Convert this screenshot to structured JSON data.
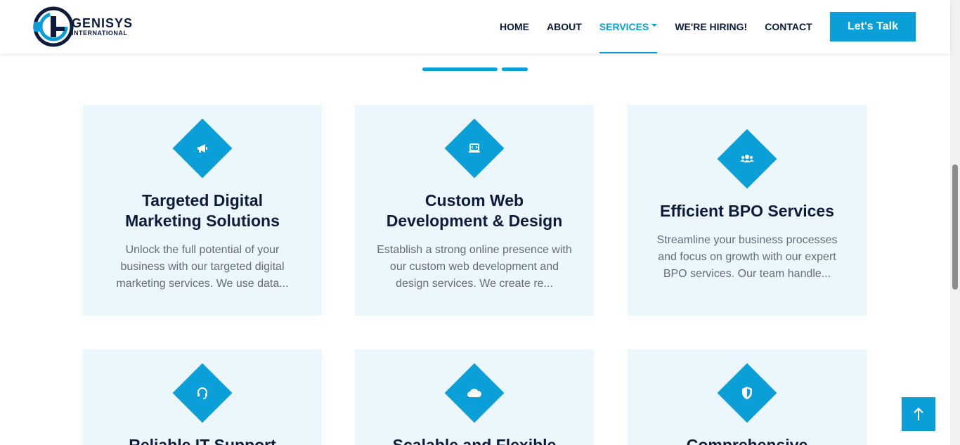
{
  "brand": {
    "name_big": "GENISYS",
    "name_small": "INTERNATIONAL"
  },
  "nav": {
    "items": [
      {
        "label": "HOME"
      },
      {
        "label": "ABOUT"
      },
      {
        "label": "SERVICES"
      },
      {
        "label": "WE'RE HIRING!"
      },
      {
        "label": "CONTACT"
      }
    ],
    "active": "SERVICES",
    "cta_label": "Let's Talk"
  },
  "colors": {
    "accent": "#0a9fd8",
    "heading": "#0d1b3d",
    "card_bg": "#ebf6fd",
    "body_text": "#666c75"
  },
  "services": [
    {
      "icon": "megaphone-icon",
      "title_line1": "Targeted Digital",
      "title_line2": "Marketing Solutions",
      "desc_line1": "Unlock the full potential of your",
      "desc_line2": "business with our targeted digital",
      "desc_line3": "marketing services. We use data..."
    },
    {
      "icon": "laptop-code-icon",
      "title_line1": "Custom Web",
      "title_line2": "Development & Design",
      "desc_line1": "Establish a strong online presence with",
      "desc_line2": "our custom web development and",
      "desc_line3": "design services. We create re..."
    },
    {
      "icon": "users-icon",
      "title_line1": "Efficient BPO Services",
      "title_line2": "",
      "desc_line1": "Streamline your business processes",
      "desc_line2": "and focus on growth with our expert",
      "desc_line3": "BPO services. Our team handle..."
    },
    {
      "icon": "headset-icon",
      "title_line1": "Reliable IT Support",
      "title_line2": ""
    },
    {
      "icon": "cloud-icon",
      "title_line1": "Scalable and Flexible",
      "title_line2": ""
    },
    {
      "icon": "shield-icon",
      "title_line1": "Comprehensive",
      "title_line2": ""
    }
  ],
  "back_to_top_icon": "arrow-up-icon"
}
